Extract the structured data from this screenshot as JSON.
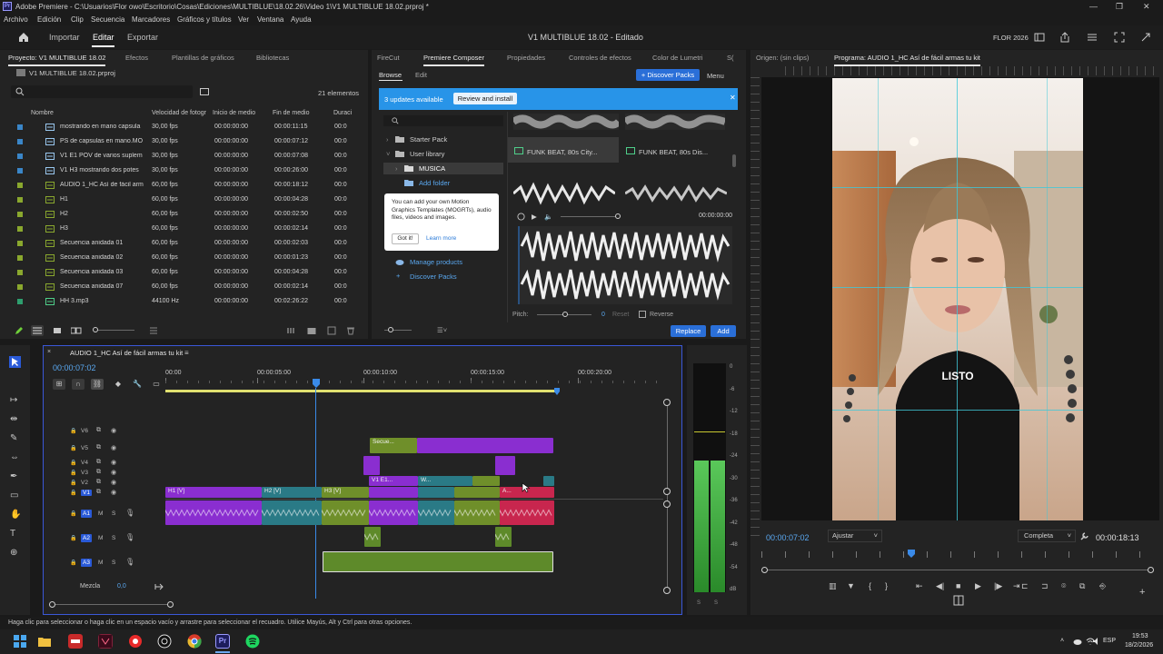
{
  "window": {
    "title": "Adobe Premiere - C:\\Usuarios\\Flor owo\\Escritorio\\Cosas\\Ediciones\\MULTIBLUE\\18.02.26\\Video 1\\V1 MULTIBLUE 18.02.prproj *",
    "logo": "Pr"
  },
  "menu": [
    "Archivo",
    "Edición",
    "Clip",
    "Secuencia",
    "Marcadores",
    "Gráficos y títulos",
    "Ver",
    "Ventana",
    "Ayuda"
  ],
  "header": {
    "nav": [
      "Importar",
      "Editar",
      "Exportar"
    ],
    "active": "Editar",
    "project_title": "V1 MULTIBLUE 18.02 - Editado",
    "user": "FLOR 2026"
  },
  "project_panel": {
    "tabs": [
      "Proyecto: V1 MULTIBLUE 18.02",
      "Efectos",
      "Plantillas de gráficos",
      "Bibliotecas"
    ],
    "file": "V1 MULTIBLUE 18.02.prproj",
    "items_count": "21 elementos",
    "columns": [
      "Nombre",
      "Velocidad de fotogr",
      "Inicio de medio",
      "Fin de medio",
      "Duraci"
    ],
    "rows": [
      {
        "name": "mostrando en mano capsula",
        "fps": "30,00 fps",
        "start": "00:00:00:00",
        "end": "00:00:11:15",
        "dur": "00:0",
        "color": "#3a86c8",
        "kind": "video"
      },
      {
        "name": "PS de capsulas en mano.MO",
        "fps": "30,00 fps",
        "start": "00:00:00:00",
        "end": "00:00:07:12",
        "dur": "00:0",
        "color": "#3a86c8",
        "kind": "video"
      },
      {
        "name": "V1 E1 POV de varios suplem",
        "fps": "30,00 fps",
        "start": "00:00:00:00",
        "end": "00:00:07:08",
        "dur": "00:0",
        "color": "#3a86c8",
        "kind": "video"
      },
      {
        "name": "V1 H3 mostrando dos potes",
        "fps": "30,00 fps",
        "start": "00:00:00:00",
        "end": "00:00:26:00",
        "dur": "00:0",
        "color": "#3a86c8",
        "kind": "video"
      },
      {
        "name": "AUDIO 1_HC Así de fácil arm",
        "fps": "60,00 fps",
        "start": "00:00:00:00",
        "end": "00:00:18:12",
        "dur": "00:0",
        "color": "#8aa82e",
        "kind": "seq"
      },
      {
        "name": "H1",
        "fps": "60,00 fps",
        "start": "00:00:00:00",
        "end": "00:00:04:28",
        "dur": "00:0",
        "color": "#8aa82e",
        "kind": "seq"
      },
      {
        "name": "H2",
        "fps": "60,00 fps",
        "start": "00:00:00:00",
        "end": "00:00:02:50",
        "dur": "00:0",
        "color": "#8aa82e",
        "kind": "seq"
      },
      {
        "name": "H3",
        "fps": "60,00 fps",
        "start": "00:00:00:00",
        "end": "00:00:02:14",
        "dur": "00:0",
        "color": "#8aa82e",
        "kind": "seq"
      },
      {
        "name": "Secuencia anidada 01",
        "fps": "60,00 fps",
        "start": "00:00:00:00",
        "end": "00:00:02:03",
        "dur": "00:0",
        "color": "#8aa82e",
        "kind": "seq"
      },
      {
        "name": "Secuencia anidada 02",
        "fps": "60,00 fps",
        "start": "00:00:00:00",
        "end": "00:00:01:23",
        "dur": "00:0",
        "color": "#8aa82e",
        "kind": "seq"
      },
      {
        "name": "Secuencia anidada 03",
        "fps": "60,00 fps",
        "start": "00:00:00:00",
        "end": "00:00:04:28",
        "dur": "00:0",
        "color": "#8aa82e",
        "kind": "seq"
      },
      {
        "name": "Secuencia anidada 07",
        "fps": "60,00 fps",
        "start": "00:00:00:00",
        "end": "00:00:02:14",
        "dur": "00:0",
        "color": "#8aa82e",
        "kind": "seq"
      },
      {
        "name": "HH 3.mp3",
        "fps": "44100 Hz",
        "start": "00:00:00:00",
        "end": "00:02:26:22",
        "dur": "00:0",
        "color": "#2e9e6e",
        "kind": "audio"
      }
    ]
  },
  "composer": {
    "tabs": [
      "FireCut",
      "Premiere Composer",
      "Propiedades",
      "Controles de efectos",
      "Color de Lumetri",
      "S("
    ],
    "subtabs": [
      "Browse",
      "Edit"
    ],
    "discover_button": "+ Discover Packs",
    "menu_label": "Menu",
    "banner_text": "3 updates available",
    "banner_button": "Review and install",
    "folders": {
      "starter": "Starter Pack",
      "user_library": "User library",
      "musica": "MUSICA",
      "add_folder": "Add folder"
    },
    "tracks": [
      "FUNK BEAT, 80s City...",
      "FUNK BEAT, 80s Dis..."
    ],
    "time": "00:00:00:00",
    "tooltip_text": "You can add your own Motion Graphics Templates (MOGRTs), audio files, videos and images.",
    "tooltip_button": "Got it!",
    "tooltip_link": "Learn more",
    "manage_products": "Manage products",
    "discover_packs": "Discover Packs",
    "pitch_label": "Pitch:",
    "pitch_value": "0",
    "reset": "Reset",
    "reverse": "Reverse",
    "replace_button": "Replace",
    "add_button": "Add"
  },
  "program_monitor": {
    "tabs": [
      "Origen: (sin clips)",
      "Programa: AUDIO 1_HC Así de fácil armas tu kit"
    ],
    "caption": "LISTO",
    "timecode": "00:00:07:02",
    "fit": "Ajustar",
    "quality": "Completa",
    "duration": "00:00:18:13"
  },
  "timeline": {
    "tab": "AUDIO 1_HC Así de fácil armas tu kit",
    "timecode": "00:00:07:02",
    "ruler": [
      "00:00",
      "00:00:05:00",
      "00:00:10:00",
      "00:00:15:00",
      "00:00:20:00"
    ],
    "video_tracks": [
      "V6",
      "V5",
      "V4",
      "V3",
      "V2",
      "V1"
    ],
    "audio_tracks": [
      "A1",
      "A2",
      "A3"
    ],
    "mix_label": "Mezcla",
    "mix_value": "0,0",
    "clips": {
      "secu": "Secue...",
      "h1": "H1 [V]",
      "h2": "H2 [V]",
      "h3": "H3 [V]",
      "v1e1": "V1 E1...",
      "w": "W...",
      "a": "A..."
    }
  },
  "meter": {
    "scale": [
      "0",
      "-6",
      "-12",
      "-18",
      "-24",
      "-30",
      "-36",
      "-42",
      "-48",
      "-54",
      "dB"
    ],
    "ss": [
      "S",
      "S"
    ]
  },
  "status_bar": "Haga clic para seleccionar o haga clic en un espacio vacío y arrastre para seleccionar el recuadro. Utilice Mayús, Alt y Ctrl para otras opciones.",
  "taskbar": {
    "lang": "ESP",
    "time": "19:53",
    "date": "18/2/2026",
    "pr_label": "Pr"
  },
  "colors": {
    "accent_blue": "#2a7ad8",
    "sequence_green": "#6f8f2a",
    "clip_purple": "#8a2ed0",
    "clip_teal": "#2a7a86",
    "clip_pink": "#c8264e",
    "audio_green": "#5e8a2a"
  }
}
